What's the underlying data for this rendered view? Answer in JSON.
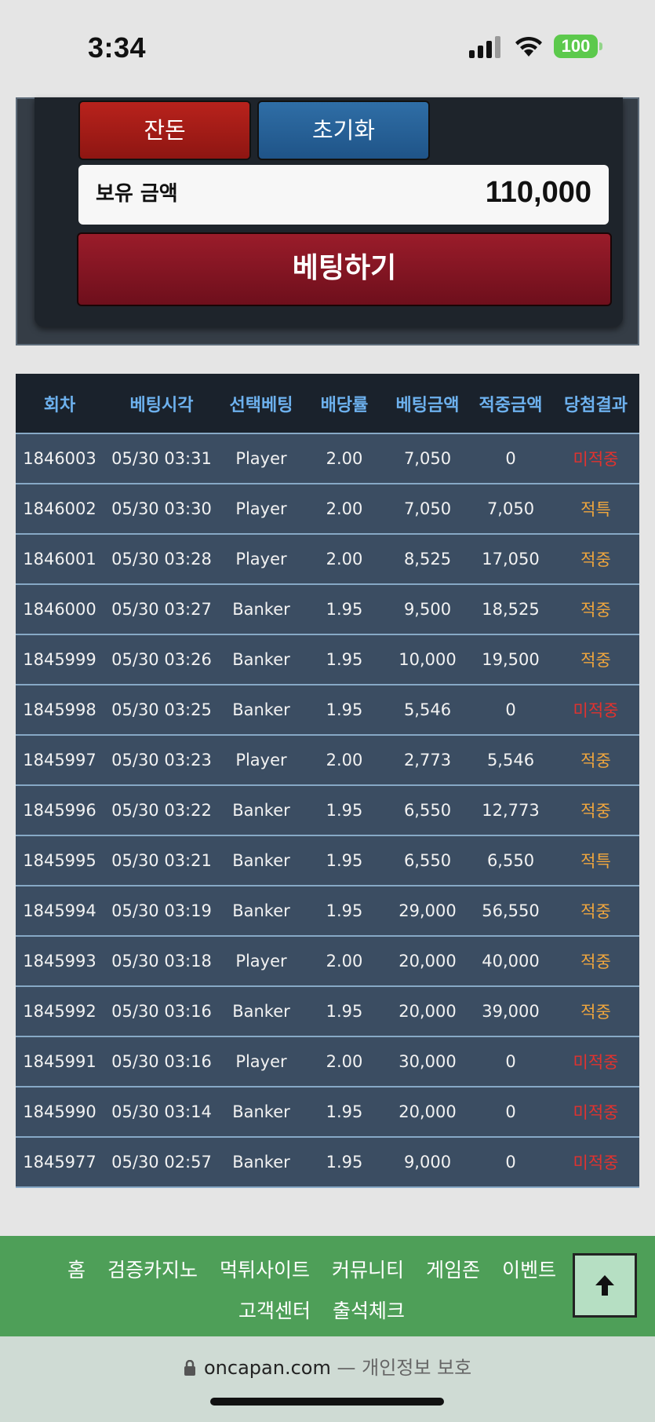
{
  "status_bar": {
    "time": "3:34",
    "battery": "100",
    "icons": [
      "signal-icon",
      "wifi-icon",
      "battery-icon"
    ]
  },
  "bet_panel": {
    "balance_button": "잔돈",
    "reset_button": "초기화",
    "holding_label": "보유 금액",
    "holding_value": "110,000",
    "bet_button": "베팅하기"
  },
  "table": {
    "headers": [
      "회차",
      "베팅시각",
      "선택베팅",
      "배당률",
      "베팅금액",
      "적중금액",
      "당첨결과"
    ],
    "rows": [
      [
        "1846003",
        "05/30 03:31",
        "Player",
        "2.00",
        "7,050",
        "0",
        "미적중"
      ],
      [
        "1846002",
        "05/30 03:30",
        "Player",
        "2.00",
        "7,050",
        "7,050",
        "적특"
      ],
      [
        "1846001",
        "05/30 03:28",
        "Player",
        "2.00",
        "8,525",
        "17,050",
        "적중"
      ],
      [
        "1846000",
        "05/30 03:27",
        "Banker",
        "1.95",
        "9,500",
        "18,525",
        "적중"
      ],
      [
        "1845999",
        "05/30 03:26",
        "Banker",
        "1.95",
        "10,000",
        "19,500",
        "적중"
      ],
      [
        "1845998",
        "05/30 03:25",
        "Banker",
        "1.95",
        "5,546",
        "0",
        "미적중"
      ],
      [
        "1845997",
        "05/30 03:23",
        "Player",
        "2.00",
        "2,773",
        "5,546",
        "적중"
      ],
      [
        "1845996",
        "05/30 03:22",
        "Banker",
        "1.95",
        "6,550",
        "12,773",
        "적중"
      ],
      [
        "1845995",
        "05/30 03:21",
        "Banker",
        "1.95",
        "6,550",
        "6,550",
        "적특"
      ],
      [
        "1845994",
        "05/30 03:19",
        "Banker",
        "1.95",
        "29,000",
        "56,550",
        "적중"
      ],
      [
        "1845993",
        "05/30 03:18",
        "Player",
        "2.00",
        "20,000",
        "40,000",
        "적중"
      ],
      [
        "1845992",
        "05/30 03:16",
        "Banker",
        "1.95",
        "20,000",
        "39,000",
        "적중"
      ],
      [
        "1845991",
        "05/30 03:16",
        "Player",
        "2.00",
        "30,000",
        "0",
        "미적중"
      ],
      [
        "1845990",
        "05/30 03:14",
        "Banker",
        "1.95",
        "20,000",
        "0",
        "미적중"
      ],
      [
        "1845977",
        "05/30 02:57",
        "Banker",
        "1.95",
        "9,000",
        "0",
        "미적중"
      ]
    ],
    "result_colors": {
      "hit": "#f0a63d",
      "miss": "#e3322e"
    }
  },
  "footer_nav": {
    "row1": [
      "홈",
      "검증카지노",
      "먹튀사이트",
      "커뮤니티",
      "게임존",
      "이벤트"
    ],
    "row2": [
      "고객센터",
      "출석체크"
    ]
  },
  "url_bar": {
    "domain": "oncapan.com",
    "separator": "—",
    "privacy": "개인정보 보호"
  }
}
